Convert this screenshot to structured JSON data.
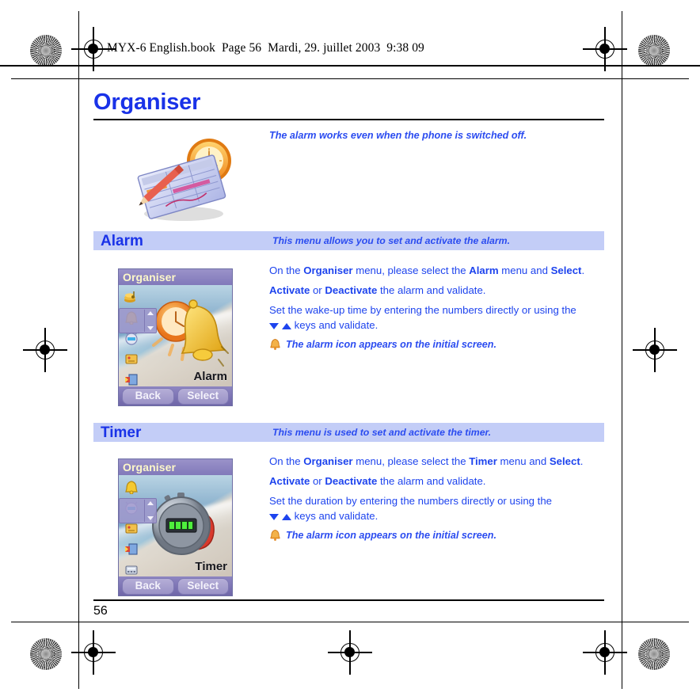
{
  "document": {
    "book_header": "MYX-6 English.book  Page 56  Mardi, 29. juillet 2003  9:38 09",
    "chapter_title": "Organiser",
    "intro_note": "The alarm works even when the phone is switched off.",
    "folio": "56",
    "colors": {
      "heading_blue": "#1932e8",
      "body_blue": "#1e44ee",
      "note_blue": "#2b4cf0",
      "band_lavender": "#c3cdf7"
    }
  },
  "hero_illustration": {
    "name": "organiser-planner-clock-illustration",
    "alt": "Planner with pencil and alarm clock"
  },
  "sections": [
    {
      "id": "alarm",
      "band_title": "Alarm",
      "band_desc": "This menu allows you to set and activate the alarm.",
      "paragraphs": [
        {
          "parts": [
            {
              "t": "On the ",
              "b": false
            },
            {
              "t": "Organiser",
              "b": true
            },
            {
              "t": " menu, please select the ",
              "b": false
            },
            {
              "t": "Alarm",
              "b": true
            },
            {
              "t": " menu and ",
              "b": false
            },
            {
              "t": "Select",
              "b": true
            },
            {
              "t": ".",
              "b": false
            }
          ]
        },
        {
          "parts": [
            {
              "t": "Activate",
              "b": true
            },
            {
              "t": " or ",
              "b": false
            },
            {
              "t": "Deactivate",
              "b": true
            },
            {
              "t": " the alarm and validate.",
              "b": false
            }
          ]
        }
      ],
      "justified_lead": "Set the wake-up time by entering the numbers directly or using the",
      "justified_tail": "keys and validate.",
      "note": "The alarm icon appears on the initial screen.",
      "note_icon": "bell-icon",
      "phone": {
        "title": "Organiser",
        "caption": "Alarm",
        "softkey_left": "Back",
        "softkey_right": "Select",
        "selected_index": 1,
        "rail_icons": [
          {
            "name": "coins-music-icon",
            "glyph": "🎵"
          },
          {
            "name": "bell-icon",
            "glyph": "🔔"
          },
          {
            "name": "alarm-clock-icon",
            "glyph": "⏰"
          },
          {
            "name": "notebook-icon",
            "glyph": "📒"
          },
          {
            "name": "media-book-icon",
            "glyph": "📘"
          }
        ],
        "hero_icon": "bell-and-clock-icon"
      }
    },
    {
      "id": "timer",
      "band_title": "Timer",
      "band_desc": "This menu is used to set and activate the timer.",
      "paragraphs": [
        {
          "parts": [
            {
              "t": "On the ",
              "b": false
            },
            {
              "t": "Organiser",
              "b": true
            },
            {
              "t": " menu, please select the ",
              "b": false
            },
            {
              "t": "Timer",
              "b": true
            },
            {
              "t": " menu and ",
              "b": false
            },
            {
              "t": "Select",
              "b": true
            },
            {
              "t": ".",
              "b": false
            }
          ]
        },
        {
          "parts": [
            {
              "t": "Activate",
              "b": true
            },
            {
              "t": " or ",
              "b": false
            },
            {
              "t": "Deactivate",
              "b": true
            },
            {
              "t": " the alarm and validate.",
              "b": false
            }
          ]
        }
      ],
      "justified_lead": "Set the duration by entering the numbers directly or using the",
      "justified_tail": "keys and validate.",
      "note": "The alarm icon appears on the initial screen.",
      "note_icon": "bell-icon",
      "phone": {
        "title": "Organiser",
        "caption": "Timer",
        "softkey_left": "Back",
        "softkey_right": "Select",
        "selected_index": 1,
        "rail_icons": [
          {
            "name": "bell-icon",
            "glyph": "🔔"
          },
          {
            "name": "alarm-clock-icon",
            "glyph": "⏰"
          },
          {
            "name": "notebook-icon",
            "glyph": "📒"
          },
          {
            "name": "media-book-icon",
            "glyph": "📘"
          },
          {
            "name": "calculator-icon",
            "glyph": "🖩"
          }
        ],
        "hero_icon": "stopwatch-icon"
      }
    }
  ]
}
